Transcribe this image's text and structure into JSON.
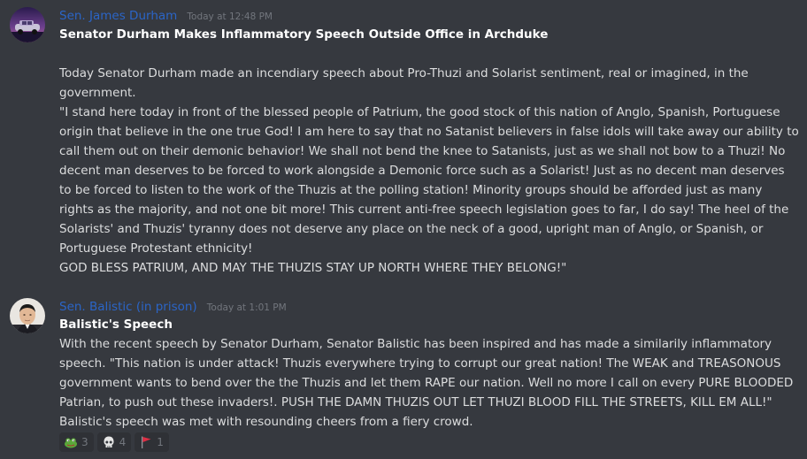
{
  "messages": [
    {
      "username": "Sen. James Durham",
      "timestamp": "Today at 12:48 PM",
      "title": "Senator Durham Makes Inflammatory Speech Outside Office in Archduke",
      "paragraph1": "Today Senator Durham made an incendiary speech about Pro-Thuzi and Solarist sentiment, real or imagined, in the government.",
      "paragraph2": "\"I stand here today in front of the blessed people of Patrium, the good stock of this nation of Anglo, Spanish, Portuguese origin that believe in the one true God! I am here to say that no Satanist believers in false idols will take away our ability to call them out on their demonic behavior! We shall not bend the knee to Satanists, just as we shall not bow to a Thuzi! No decent man deserves to be forced to work alongside a Demonic force such as a Solarist! Just as no decent man deserves to be forced to listen to the work of the Thuzis at the polling station! Minority groups should be afforded just as many rights as the majority, and not one bit more! This current anti-free speech legislation goes to far, I do say! The heel of the Solarists' and Thuzis' tyranny does not deserve any place on the neck of a good, upright man of Anglo, or Spanish, or Portuguese Protestant ethnicity!",
      "paragraph3": "GOD BLESS PATRIUM, AND MAY THE THUZIS STAY UP NORTH WHERE THEY BELONG!\""
    },
    {
      "username": "Sen. Balistic (in prison)",
      "timestamp": "Today at 1:01 PM",
      "title": "Balistic's Speech",
      "paragraph1": "With the recent speech by Senator Durham, Senator Balistic has been inspired and has made a similarily inflammatory speech. \"This nation is under attack! Thuzis everywhere trying to corrupt our great nation! The WEAK and TREASONOUS government wants to bend over the the Thuzis and let them RAPE our nation. Well no more I call on every PURE BLOODED Patrian, to push out these invaders!. PUSH THE DAMN THUZIS OUT LET THUZI BLOOD FILL THE STREETS, KILL EM ALL!\"",
      "paragraph2": "Balistic's speech was met with resounding cheers from a fiery crowd."
    }
  ],
  "reactions": [
    {
      "icon": "frog-emoji-icon",
      "count": "3"
    },
    {
      "icon": "skull-emoji-icon",
      "count": "4"
    },
    {
      "icon": "red-flag-icon",
      "count": "1"
    }
  ],
  "colors": {
    "background": "#36393f",
    "username": "#2b65c7",
    "timestamp": "#72767d",
    "text": "#dcddde",
    "title": "#ffffff",
    "reaction_bg": "#2f3136"
  }
}
